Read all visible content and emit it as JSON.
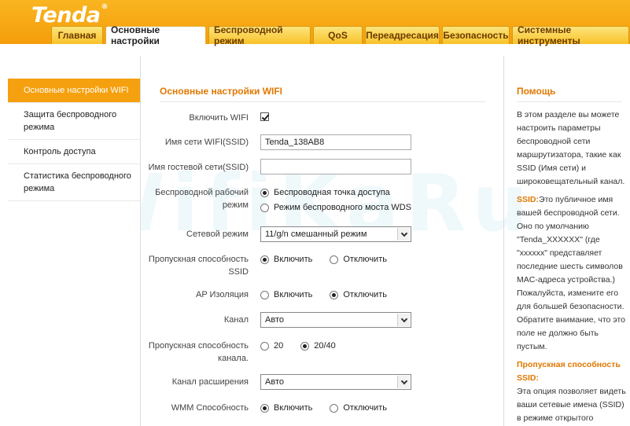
{
  "brand": {
    "logo": "Tenda"
  },
  "nav_tabs": [
    {
      "label": "Главная"
    },
    {
      "label": "Основные настройки"
    },
    {
      "label": "Беспроводной режим"
    },
    {
      "label": "QoS"
    },
    {
      "label": "Переадресация"
    },
    {
      "label": "Безопасность"
    },
    {
      "label": "Системные инструменты"
    }
  ],
  "sidebar": {
    "items": [
      {
        "label": "Основные настройки WIFI"
      },
      {
        "label": "Защита беспроводного режима"
      },
      {
        "label": "Контроль доступа"
      },
      {
        "label": "Статистика беспроводного режима"
      }
    ]
  },
  "main": {
    "title": "Основные настройки WIFI",
    "enable_wifi": {
      "label": "Включить WIFI"
    },
    "ssid": {
      "label": "Имя сети WIFI(SSID)",
      "value": "Tenda_138AB8"
    },
    "guest_ssid": {
      "label": "Имя гостевой сети(SSID)",
      "value": ""
    },
    "work_mode": {
      "label": "Беспроводной рабочий режим",
      "opt1": "Беспроводная точка доступа",
      "opt2": "Режим беспроводного моста WDS"
    },
    "net_mode": {
      "label": "Сетевой режим",
      "value": "11/g/n смешанный режим"
    },
    "ssid_broadcast": {
      "label": "Пропускная способность SSID",
      "opt1": "Включить",
      "opt2": "Отключить"
    },
    "ap_isolation": {
      "label": "AP Изоляция",
      "opt1": "Включить",
      "opt2": "Отключить"
    },
    "channel": {
      "label": "Канал",
      "value": "Авто"
    },
    "bandwidth": {
      "label": "Пропускная способность канала.",
      "opt1": "20",
      "opt2": "20/40"
    },
    "ext_channel": {
      "label": "Канал расширения",
      "value": "Авто"
    },
    "wmm": {
      "label": "WMM Способность",
      "opt1": "Включить",
      "opt2": "Отключить"
    }
  },
  "help": {
    "title": "Помощь",
    "p1": "В этом разделе вы можете настроить параметры беспроводной сети маршрутизатора, такие как SSID (Имя сети) и широковещательный канал.",
    "p2_key": "SSID:",
    "p2": "Это публичное имя вашей беспроводной сети. Оно по умолчанию \"Tenda_XXXXXX\" (где \"xxxxxx\" представляет последние шесть символов MAC-адреса устройства.) Пожалуйста, измените его для большей безопасности. Обратите внимание, что это поле не должно быть пустым.",
    "p3_key": "Пропускная способность SSID:",
    "p3": "Эта опция позволяет видеть ваши сетевые имена (SSID) в режиме открытого просмотра или если вы"
  },
  "watermark": "WifiKaRu"
}
